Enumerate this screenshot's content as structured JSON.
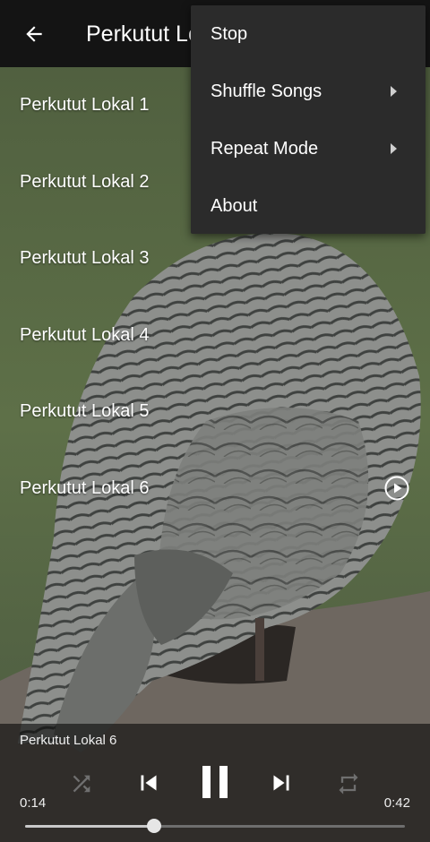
{
  "app": {
    "title": "Perkutut Lokal"
  },
  "songs": [
    {
      "label": "Perkutut Lokal 1",
      "playing": false
    },
    {
      "label": "Perkutut Lokal 2",
      "playing": false
    },
    {
      "label": "Perkutut Lokal 3",
      "playing": false
    },
    {
      "label": "Perkutut Lokal 4",
      "playing": false
    },
    {
      "label": "Perkutut Lokal 5",
      "playing": false
    },
    {
      "label": "Perkutut Lokal 6",
      "playing": true
    }
  ],
  "menu": {
    "items": [
      {
        "label": "Stop",
        "has_submenu": false
      },
      {
        "label": "Shuffle Songs",
        "has_submenu": true
      },
      {
        "label": "Repeat Mode",
        "has_submenu": true
      },
      {
        "label": "About",
        "has_submenu": false
      }
    ]
  },
  "player": {
    "now_playing": "Perkutut Lokal 6",
    "elapsed": "0:14",
    "duration": "0:42",
    "progress_fraction": 0.34,
    "state": "playing"
  },
  "icons": {
    "back": "arrow-left-icon",
    "play": "play-circle-icon",
    "shuffle": "shuffle-icon",
    "previous": "skip-previous-icon",
    "pause": "pause-icon",
    "next": "skip-next-icon",
    "repeat": "repeat-icon",
    "submenu": "chevron-right-icon"
  },
  "colors": {
    "appbar": "#141414",
    "menu": "#2b2b2b",
    "background_green": "#5b6b47"
  }
}
